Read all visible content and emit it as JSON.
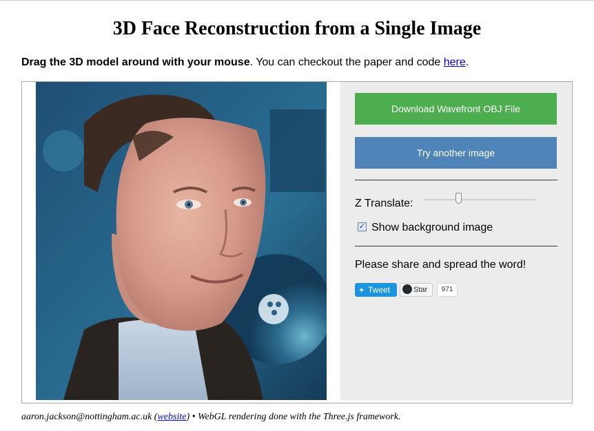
{
  "page": {
    "title": "3D Face Reconstruction from a Single Image",
    "intro": {
      "bold": "Drag the 3D model around with your mouse",
      "rest": ". You can checkout the paper and code ",
      "link": "here",
      "end": "."
    }
  },
  "viewer": {
    "background_color": "#000000"
  },
  "controls": {
    "download_button": "Download Wavefront OBJ File",
    "another_button": "Try another image",
    "z_translate_label": "Z Translate:",
    "z_translate_value": 0.3,
    "show_background_label": "Show background image",
    "show_background_checked": true,
    "share_text": "Please share and spread the word!",
    "tweet_label": "Tweet",
    "star_label": "Star",
    "star_count": "971",
    "colors": {
      "download": "#4cae4f",
      "another": "#4f84b8",
      "panel": "#ececec"
    }
  },
  "footer": {
    "email": "aaron.jackson@nottingham.ac.uk",
    "open_paren": " (",
    "website_link": "website",
    "rest": ") • WebGL rendering done with the Three.js framework."
  }
}
